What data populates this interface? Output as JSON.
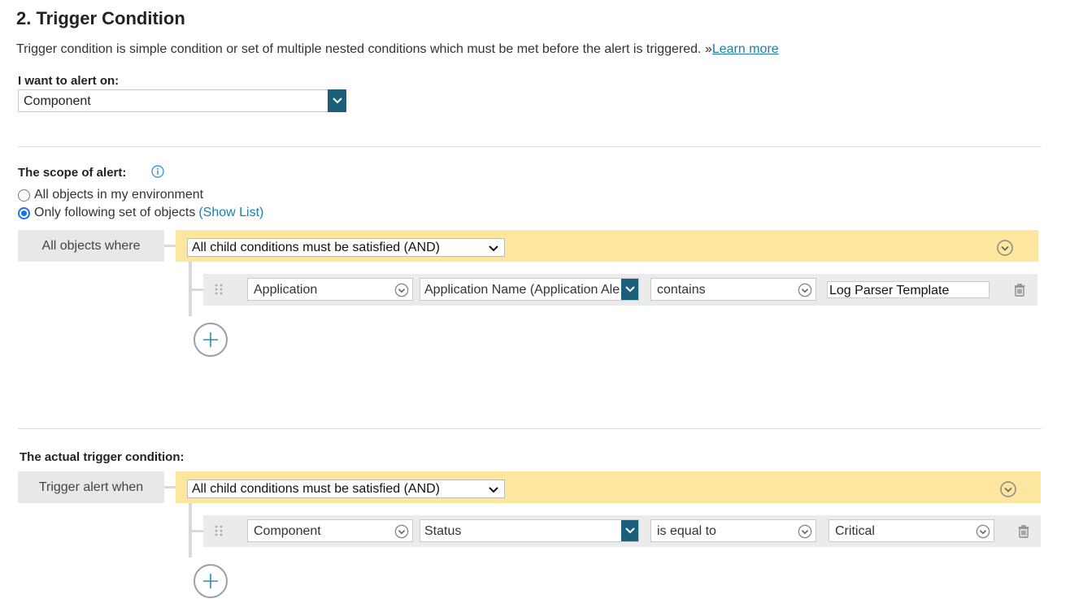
{
  "section": {
    "title": "2. Trigger Condition",
    "description": "Trigger condition is simple condition or set of multiple nested conditions which must be met before the alert is triggered. »",
    "learn_more": "Learn more"
  },
  "alert_on": {
    "label": "I want to alert on:",
    "value": "Component"
  },
  "scope": {
    "label": "The scope of alert:",
    "option_all": "All objects in my environment",
    "option_following": "Only following set of objects",
    "show_list": "(Show List)",
    "selected": "option_following",
    "group_label": "All objects where",
    "group_operator": "All child conditions must be satisfied (AND)",
    "condition": {
      "object": "Application",
      "property": "Application Name (Application Ale",
      "operator": "contains",
      "value": "Log Parser Template"
    }
  },
  "trigger": {
    "label": "The actual trigger condition:",
    "group_label": "Trigger alert when",
    "group_operator": "All child conditions must be satisfied (AND)",
    "condition": {
      "object": "Component",
      "property": "Status",
      "operator": "is equal to",
      "value": "Critical"
    }
  },
  "icons": {
    "info": "info-icon",
    "chevron": "chevron-down-icon",
    "circle_chevron": "circle-chevron-down-icon",
    "drag": "drag-handle-icon",
    "trash": "trash-icon",
    "add": "plus-icon"
  },
  "colors": {
    "accent": "#1c5f7a",
    "link": "#1a7fa8",
    "group_bar": "#fde79e",
    "label_bg": "#e8e8e8"
  }
}
